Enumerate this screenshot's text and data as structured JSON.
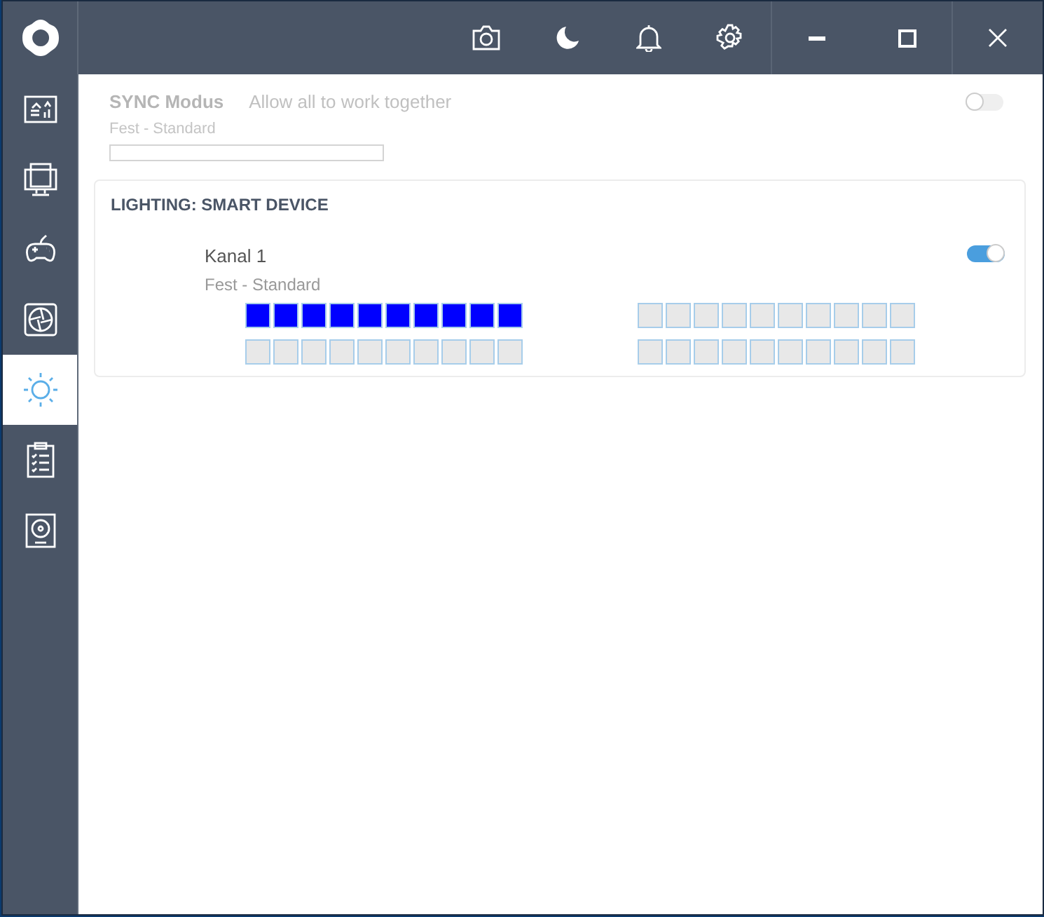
{
  "sidebar": {
    "items": [
      {
        "kind": "dashboard",
        "selected": false
      },
      {
        "kind": "monitor",
        "selected": false
      },
      {
        "kind": "gamepad",
        "selected": false
      },
      {
        "kind": "fan",
        "selected": false
      },
      {
        "kind": "lighting",
        "selected": true
      },
      {
        "kind": "checklist",
        "selected": false
      },
      {
        "kind": "disk",
        "selected": false
      }
    ]
  },
  "sync": {
    "title": "SYNC Modus",
    "description": "Allow all to work together",
    "mode": "Fest - Standard",
    "on": false,
    "disabled": true
  },
  "card": {
    "title": "LIGHTING: SMART DEVICE",
    "channel": {
      "name": "Kanal 1",
      "mode": "Fest - Standard",
      "on": true,
      "led_groups": [
        [
          {
            "color": "#0000ff"
          },
          {
            "color": "#0000ff"
          },
          {
            "color": "#0000ff"
          },
          {
            "color": "#0000ff"
          },
          {
            "color": "#0000ff"
          },
          {
            "color": "#0000ff"
          },
          {
            "color": "#0000ff"
          },
          {
            "color": "#0000ff"
          },
          {
            "color": "#0000ff"
          },
          {
            "color": "#0000ff"
          }
        ],
        [
          {
            "color": "#e8e8e8"
          },
          {
            "color": "#e8e8e8"
          },
          {
            "color": "#e8e8e8"
          },
          {
            "color": "#e8e8e8"
          },
          {
            "color": "#e8e8e8"
          },
          {
            "color": "#e8e8e8"
          },
          {
            "color": "#e8e8e8"
          },
          {
            "color": "#e8e8e8"
          },
          {
            "color": "#e8e8e8"
          },
          {
            "color": "#e8e8e8"
          }
        ],
        [
          {
            "color": "#e8e8e8"
          },
          {
            "color": "#e8e8e8"
          },
          {
            "color": "#e8e8e8"
          },
          {
            "color": "#e8e8e8"
          },
          {
            "color": "#e8e8e8"
          },
          {
            "color": "#e8e8e8"
          },
          {
            "color": "#e8e8e8"
          },
          {
            "color": "#e8e8e8"
          },
          {
            "color": "#e8e8e8"
          },
          {
            "color": "#e8e8e8"
          }
        ],
        [
          {
            "color": "#e8e8e8"
          },
          {
            "color": "#e8e8e8"
          },
          {
            "color": "#e8e8e8"
          },
          {
            "color": "#e8e8e8"
          },
          {
            "color": "#e8e8e8"
          },
          {
            "color": "#e8e8e8"
          },
          {
            "color": "#e8e8e8"
          },
          {
            "color": "#e8e8e8"
          },
          {
            "color": "#e8e8e8"
          },
          {
            "color": "#e8e8e8"
          }
        ]
      ]
    }
  }
}
